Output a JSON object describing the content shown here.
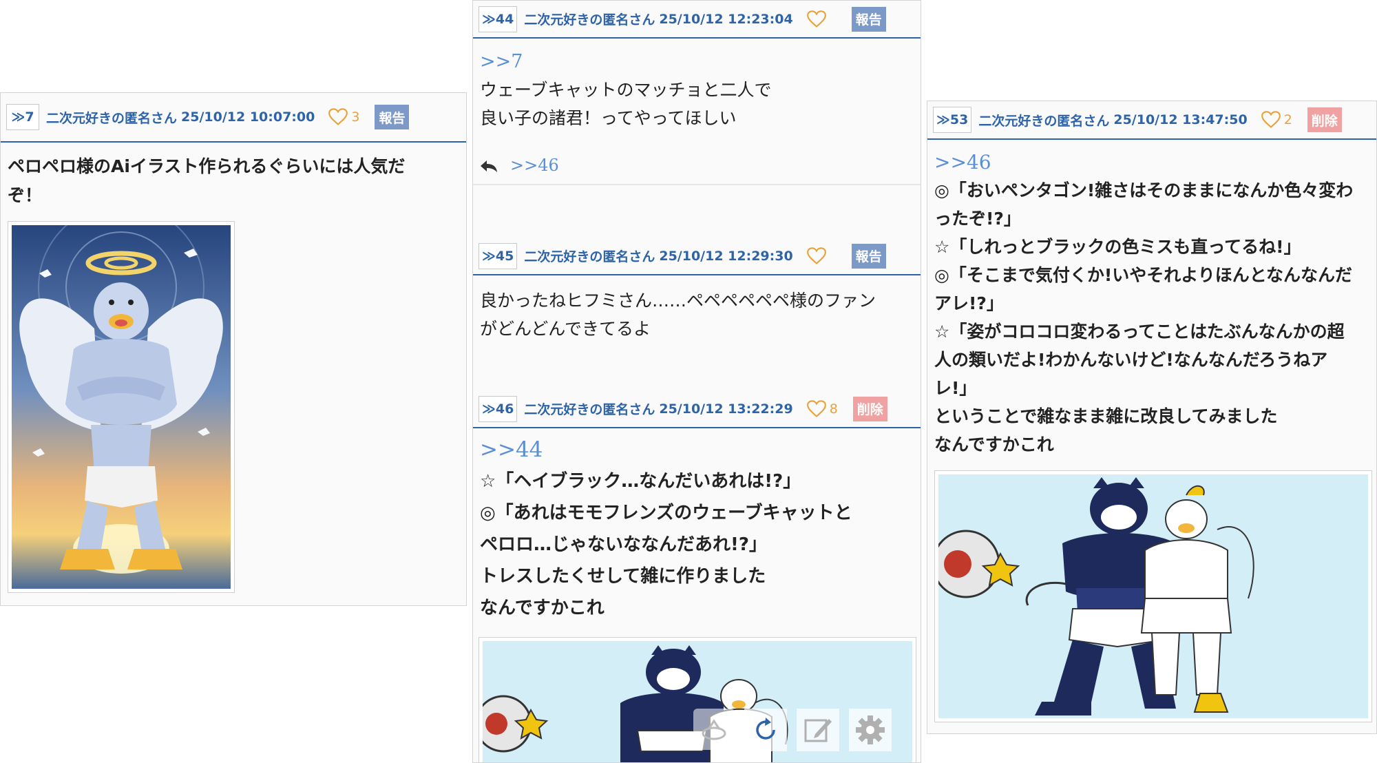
{
  "posts": {
    "p7": {
      "no": "≫7",
      "author": "二次元好きの匿名さん",
      "date": "25/10/12 10:07:00",
      "likes": "3",
      "badge": "報告",
      "lines": [
        "ペロペロ様のAiイラスト作られるぐらいには人気だ",
        "ぞ！"
      ]
    },
    "p44": {
      "no": "≫44",
      "author": "二次元好きの匿名さん",
      "date": "25/10/12 12:23:04",
      "likes": "",
      "badge": "報告",
      "anchor": ">>7",
      "lines": [
        "ウェーブキャットのマッチョと二人で",
        "良い子の諸君！ってやってほしい"
      ],
      "reply_anchor": ">>46"
    },
    "p45": {
      "no": "≫45",
      "author": "二次元好きの匿名さん",
      "date": "25/10/12 12:29:30",
      "likes": "",
      "badge": "報告",
      "lines": [
        "良かったねヒフミさん……ペペペペペペ様のファン",
        "がどんどんできてるよ"
      ]
    },
    "p46": {
      "no": "≫46",
      "author": "二次元好きの匿名さん",
      "date": "25/10/12 13:22:29",
      "likes": "8",
      "badge": "削除",
      "anchor": ">>44",
      "lines": [
        "☆「ヘイブラック…なんだいあれは!?」",
        "◎「あれはモモフレンズのウェーブキャットと",
        "ペロロ…じゃないななんだあれ!?」",
        "トレスしたくせして雑に作りました",
        "なんですかこれ"
      ]
    },
    "p53": {
      "no": "≫53",
      "author": "二次元好きの匿名さん",
      "date": "25/10/12 13:47:50",
      "likes": "2",
      "badge": "削除",
      "anchor": ">>46",
      "lines": [
        "◎「おいペンタゴン!雑さはそのままになんか色々変わ",
        "ったぞ!?」",
        "☆「しれっとブラックの色ミスも直ってるね!」",
        "◎「そこまで気付くか!いやそれよりほんとなんなんだ",
        "アレ!?」",
        "☆「姿がコロコロ変わるってことはたぶんなんかの超",
        "人の類いだよ!わかんないけど!なんなんだろうねア",
        "レ!」",
        "ということで雑なまま雑に改良してみました",
        "なんですかこれ"
      ]
    }
  },
  "colors": {
    "link": "#2d63a8",
    "report": "#7c99c7",
    "delete": "#f0a2a2",
    "like": "#e8a23a"
  },
  "icons": {
    "heart": "heart-icon",
    "reply": "reply-icon",
    "reload": "reload-icon",
    "edit": "edit-icon",
    "settings": "gear-icon"
  }
}
